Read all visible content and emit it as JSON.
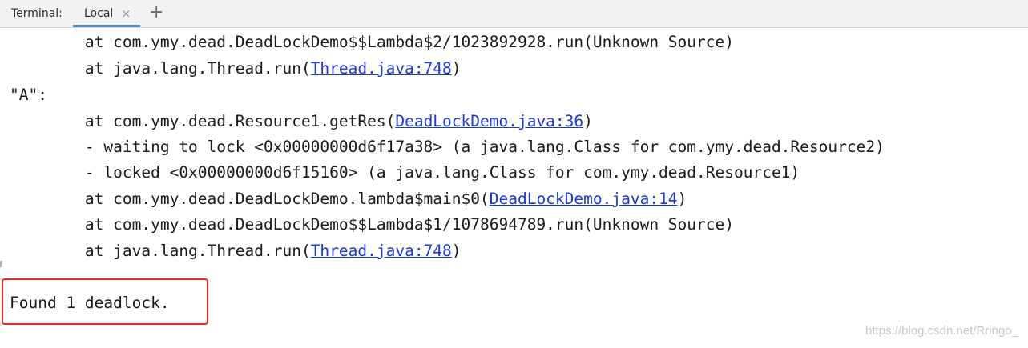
{
  "tabbar": {
    "title": "Terminal:",
    "tab_local": "Local",
    "close_glyph": "×",
    "new_tab_glyph": "+"
  },
  "terminal": {
    "lines": [
      {
        "pre": "        at com.ymy.dead.DeadLockDemo$$Lambda$2/1023892928.run(Unknown Source)",
        "link": "",
        "post": ""
      },
      {
        "pre": "        at java.lang.Thread.run(",
        "link": "Thread.java:748",
        "post": ")"
      },
      {
        "pre": "\"A\":",
        "link": "",
        "post": ""
      },
      {
        "pre": "        at com.ymy.dead.Resource1.getRes(",
        "link": "DeadLockDemo.java:36",
        "post": ")"
      },
      {
        "pre": "        - waiting to lock <0x00000000d6f17a38> (a java.lang.Class for com.ymy.dead.Resource2)",
        "link": "",
        "post": ""
      },
      {
        "pre": "        - locked <0x00000000d6f15160> (a java.lang.Class for com.ymy.dead.Resource1)",
        "link": "",
        "post": ""
      },
      {
        "pre": "        at com.ymy.dead.DeadLockDemo.lambda$main$0(",
        "link": "DeadLockDemo.java:14",
        "post": ")"
      },
      {
        "pre": "        at com.ymy.dead.DeadLockDemo$$Lambda$1/1078694789.run(Unknown Source)",
        "link": "",
        "post": ""
      },
      {
        "pre": "        at java.lang.Thread.run(",
        "link": "Thread.java:748",
        "post": ")"
      }
    ],
    "found": "Found 1 deadlock."
  },
  "watermark": "https://blog.csdn.net/Rringo_",
  "colors": {
    "link": "#1b37d6",
    "highlight_border": "#e8262c",
    "tab_underline": "#4a88c7"
  }
}
